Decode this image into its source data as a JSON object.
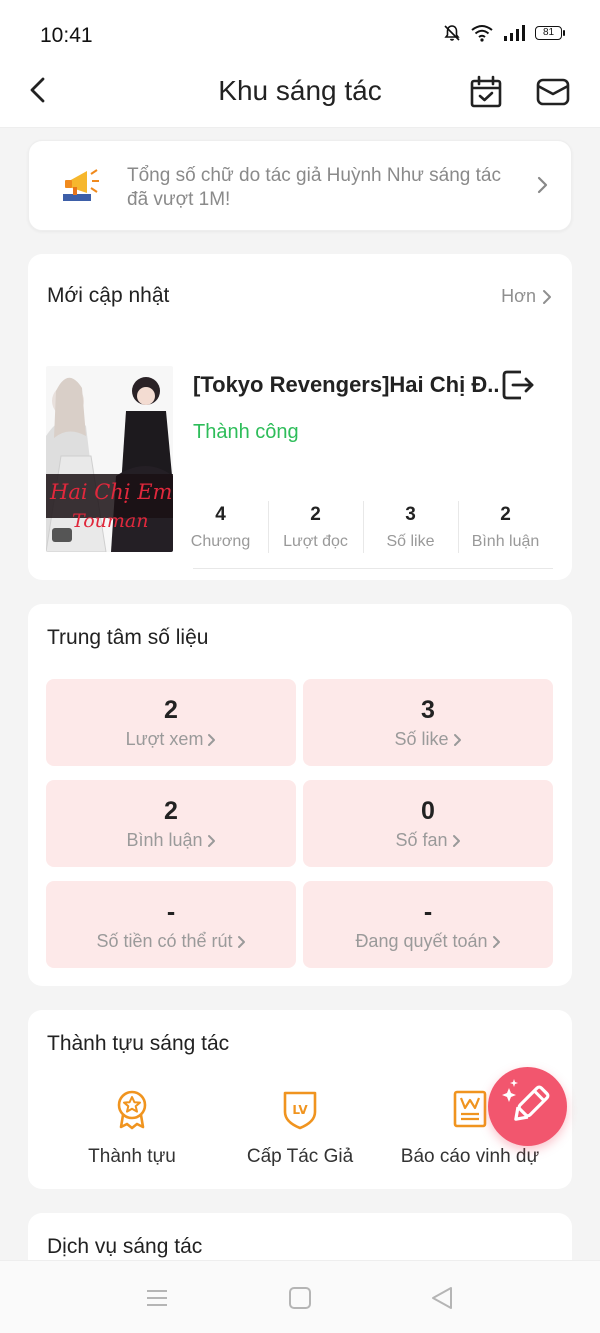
{
  "status_bar": {
    "time": "10:41",
    "battery": "81"
  },
  "header": {
    "title": "Khu sáng tác"
  },
  "notice": {
    "text": "Tổng số chữ do tác giả Huỳnh Như sáng tác đã vượt 1M!"
  },
  "updates": {
    "title": "Mới cập nhật",
    "more_label": "Hơn",
    "book": {
      "title": "[Tokyo Revengers]Hai Chị Đ...",
      "status": "Thành công",
      "status_color": "#2ebd5a",
      "cover_text_1": "Hai Chị Em",
      "cover_text_2": "Touman",
      "stats": [
        {
          "value": "4",
          "label": "Chương"
        },
        {
          "value": "2",
          "label": "Lượt đọc"
        },
        {
          "value": "3",
          "label": "Số like"
        },
        {
          "value": "2",
          "label": "Bình luận"
        }
      ]
    }
  },
  "data_center": {
    "title": "Trung tâm số liệu",
    "tiles": [
      {
        "value": "2",
        "label": "Lượt xem"
      },
      {
        "value": "3",
        "label": "Số like"
      },
      {
        "value": "2",
        "label": "Bình luận"
      },
      {
        "value": "0",
        "label": "Số fan"
      },
      {
        "value": "-",
        "label": "Số tiền có thể rút"
      },
      {
        "value": "-",
        "label": "Đang quyết toán"
      }
    ]
  },
  "achievements": {
    "title": "Thành tựu sáng tác",
    "items": [
      {
        "label": "Thành tựu",
        "icon": "medal-icon"
      },
      {
        "label": "Cấp Tác Giả",
        "icon": "level-badge-icon"
      },
      {
        "label": "Báo cáo vinh dự",
        "icon": "report-icon"
      }
    ]
  },
  "services": {
    "title": "Dịch vụ sáng tác"
  },
  "colors": {
    "accent_orange": "#f0941f",
    "tile_bg": "#fde9e9",
    "fab": "#f2566e"
  }
}
